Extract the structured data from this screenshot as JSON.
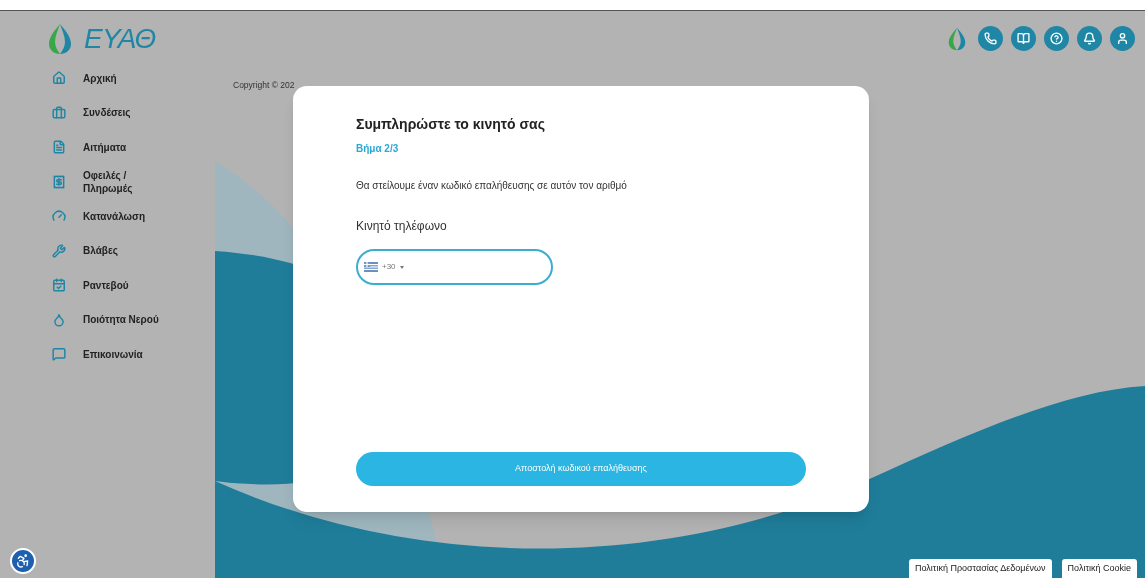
{
  "logo": {
    "text": "ΕΥΑΘ"
  },
  "sidebar": {
    "items": [
      {
        "label": "Αρχική"
      },
      {
        "label": "Συνδέσεις"
      },
      {
        "label": "Αιτήματα"
      },
      {
        "label": "Οφειλές / Πληρωμές"
      },
      {
        "label": "Κατανάλωση"
      },
      {
        "label": "Βλάβες"
      },
      {
        "label": "Ραντεβού"
      },
      {
        "label": "Ποιότητα Νερού"
      },
      {
        "label": "Επικοινωνία"
      }
    ]
  },
  "copyright": "Copyright © 202",
  "modal": {
    "title": "Συμπληρώστε το κινητό σας",
    "step": "Βήμα 2/3",
    "description": "Θα στείλουμε έναν κωδικό επαλήθευσης σε αυτόν τον αριθμό",
    "field_label": "Κινητό τηλέφωνο",
    "country_code": "+30",
    "button": "Αποστολή κωδικού επαλήθευσης"
  },
  "footer_links": [
    "Πολιτική Προστασίας Δεδομένων",
    "Πολιτική Cookie"
  ]
}
